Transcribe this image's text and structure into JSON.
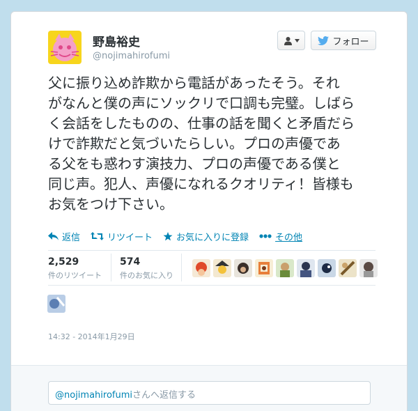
{
  "user": {
    "name": "野島裕史",
    "handle": "@nojimahirofumi"
  },
  "follow_button": {
    "label": "フォロー"
  },
  "tweet": {
    "lines": [
      "父に振り込め詐欺から電話があったそう。それ",
      "がなんと僕の声にソックリで口調も完璧。しばら",
      "く会話をしたものの、仕事の話を聞くと矛盾だら",
      "けで詐欺だと気づいたらしい。プロの声優であ",
      "る父をも惑わす演技力、プロの声優である僕と",
      "同じ声。犯人、声優になれるクオリティ！皆様も",
      "お気をつけ下さい。"
    ]
  },
  "actions": {
    "reply": "返信",
    "retweet": "リツイート",
    "favorite": "お気に入りに登録",
    "more": "その他"
  },
  "stats": {
    "retweets": {
      "count": "2,529",
      "label": "件のリツイート"
    },
    "favorites": {
      "count": "574",
      "label": "件のお気に入り"
    }
  },
  "timestamp": "14:32 - 2014年1月29日",
  "reply": {
    "mention": "@nojimahirofumi",
    "suffix": "さんへ返信する"
  },
  "colors": {
    "background": "#c0deed",
    "link": "#0084b4",
    "twitter_blue": "#55acee",
    "text": "#292f33",
    "muted": "#8899a6"
  }
}
